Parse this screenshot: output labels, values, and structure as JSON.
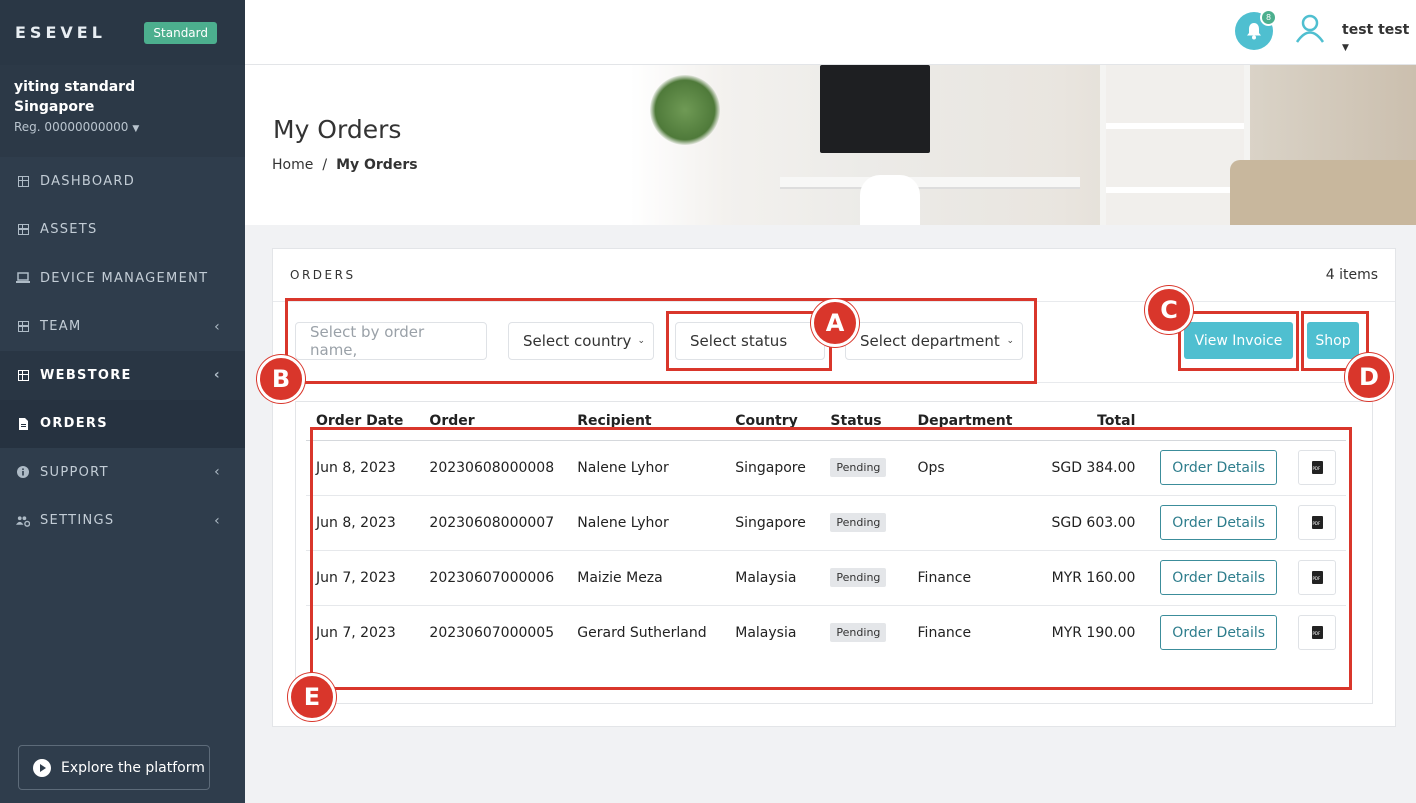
{
  "brand": {
    "name": "ESEVEL",
    "plan": "Standard"
  },
  "account": {
    "name_line1": "yiting standard",
    "name_line2": "Singapore",
    "reg": "Reg. 00000000000"
  },
  "nav": [
    {
      "label": "DASHBOARD",
      "icon": "grid-icon"
    },
    {
      "label": "ASSETS",
      "icon": "grid-icon"
    },
    {
      "label": "DEVICE MANAGEMENT",
      "icon": "laptop-icon"
    },
    {
      "label": "TEAM",
      "icon": "grid-icon"
    },
    {
      "label": "WEBSTORE",
      "icon": "grid-icon"
    },
    {
      "label": "ORDERS",
      "icon": "document-icon"
    },
    {
      "label": "SUPPORT",
      "icon": "info-icon"
    },
    {
      "label": "SETTINGS",
      "icon": "users-gear-icon"
    }
  ],
  "explore_label": "Explore the platform",
  "topbar": {
    "notification_count": "8",
    "user_name": "test test"
  },
  "page": {
    "title": "My Orders",
    "breadcrumb_home": "Home",
    "breadcrumb_sep": "/",
    "breadcrumb_current": "My Orders"
  },
  "card": {
    "title": "ORDERS",
    "count": "4 items"
  },
  "filters": {
    "search_placeholder": "Select by order name,",
    "country": "Select country",
    "status": "Select status",
    "department": "Select department"
  },
  "buttons": {
    "view_invoice": "View Invoice",
    "shop": "Shop"
  },
  "table": {
    "headers": [
      "Order Date",
      "Order",
      "Recipient",
      "Country",
      "Status",
      "Department",
      "Total"
    ],
    "details_label": "Order Details",
    "rows": [
      {
        "date": "Jun 8, 2023",
        "order": "20230608000008",
        "recipient": "Nalene Lyhor",
        "country": "Singapore",
        "status": "Pending",
        "department": "Ops",
        "total": "SGD 384.00"
      },
      {
        "date": "Jun 8, 2023",
        "order": "20230608000007",
        "recipient": "Nalene Lyhor",
        "country": "Singapore",
        "status": "Pending",
        "department": "",
        "total": "SGD 603.00"
      },
      {
        "date": "Jun 7, 2023",
        "order": "20230607000006",
        "recipient": "Maizie Meza",
        "country": "Malaysia",
        "status": "Pending",
        "department": "Finance",
        "total": "MYR 160.00"
      },
      {
        "date": "Jun 7, 2023",
        "order": "20230607000005",
        "recipient": "Gerard Sutherland",
        "country": "Malaysia",
        "status": "Pending",
        "department": "Finance",
        "total": "MYR 190.00"
      }
    ]
  },
  "annotations": {
    "a": "A",
    "b": "B",
    "c": "C",
    "d": "D",
    "e": "E"
  },
  "colors": {
    "accent": "#4fbfd0",
    "annotation": "#d9362b",
    "sidebar": "#2f3d4c",
    "badge": "#4caf8e"
  }
}
